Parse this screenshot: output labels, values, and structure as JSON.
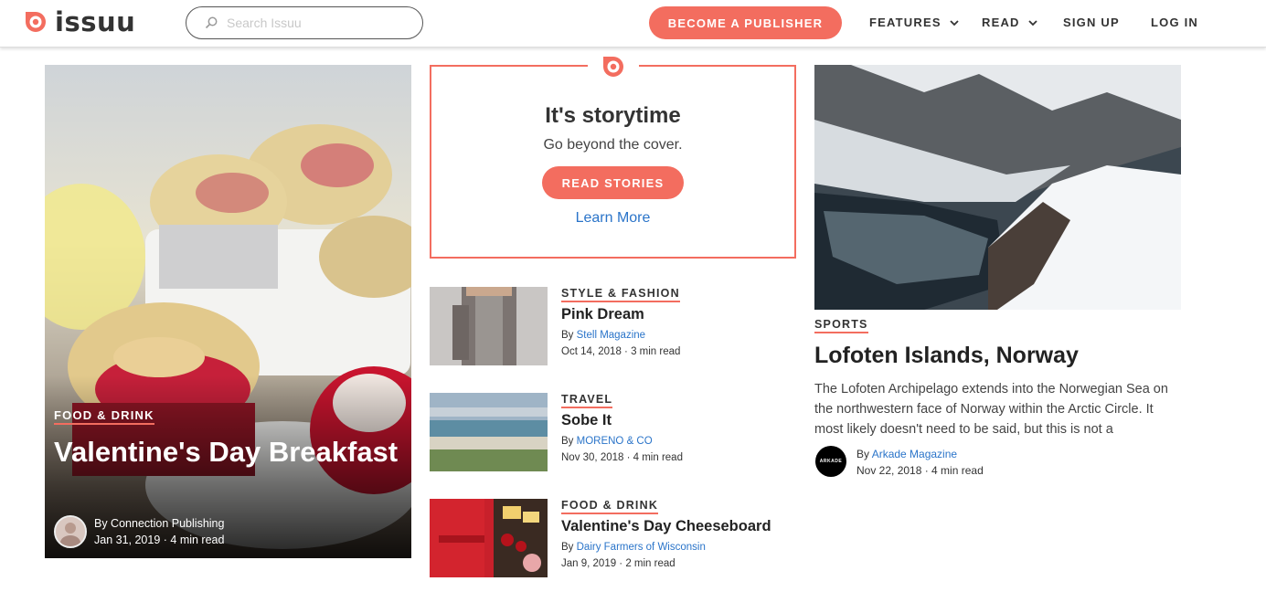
{
  "header": {
    "logo_text": "issuu",
    "search_placeholder": "Search Issuu",
    "publish_label": "BECOME A PUBLISHER",
    "nav": {
      "features": "FEATURES",
      "read": "READ",
      "signup": "SIGN UP",
      "login": "LOG IN"
    }
  },
  "colors": {
    "accent": "#f36d5f",
    "link": "#2a74c9"
  },
  "feature": {
    "category": "FOOD & DRINK",
    "title": "Valentine's Day Breakfast",
    "by": "By Connection Publishing",
    "date": "Jan 31, 2019 · 4 min read"
  },
  "storytime": {
    "title": "It's storytime",
    "subtitle": "Go beyond the cover.",
    "button": "READ STORIES",
    "link": "Learn More"
  },
  "articles": [
    {
      "category": "STYLE & FASHION",
      "title": "Pink Dream",
      "by_prefix": "By ",
      "publisher": "Stell Magazine",
      "date": "Oct 14, 2018 · 3 min read"
    },
    {
      "category": "TRAVEL",
      "title": "Sobe It",
      "by_prefix": "By ",
      "publisher": "MORENO & CO",
      "date": "Nov 30, 2018 · 4 min read"
    },
    {
      "category": "FOOD & DRINK",
      "title": "Valentine's Day Cheeseboard",
      "by_prefix": "By ",
      "publisher": "Dairy Farmers of Wisconsin",
      "date": "Jan 9, 2019 · 2 min read"
    }
  ],
  "side": {
    "category": "SPORTS",
    "title": "Lofoten Islands, Norway",
    "description": "The Lofoten Archipelago extends into the Norwegian Sea on the northwestern face of Norway within the Arctic Circle. It most likely doesn't need to be said, but this is not a",
    "avatar_text": "ARKADE",
    "by_prefix": "By ",
    "publisher": "Arkade Magazine",
    "date": "Nov 22, 2018 · 4 min read"
  }
}
